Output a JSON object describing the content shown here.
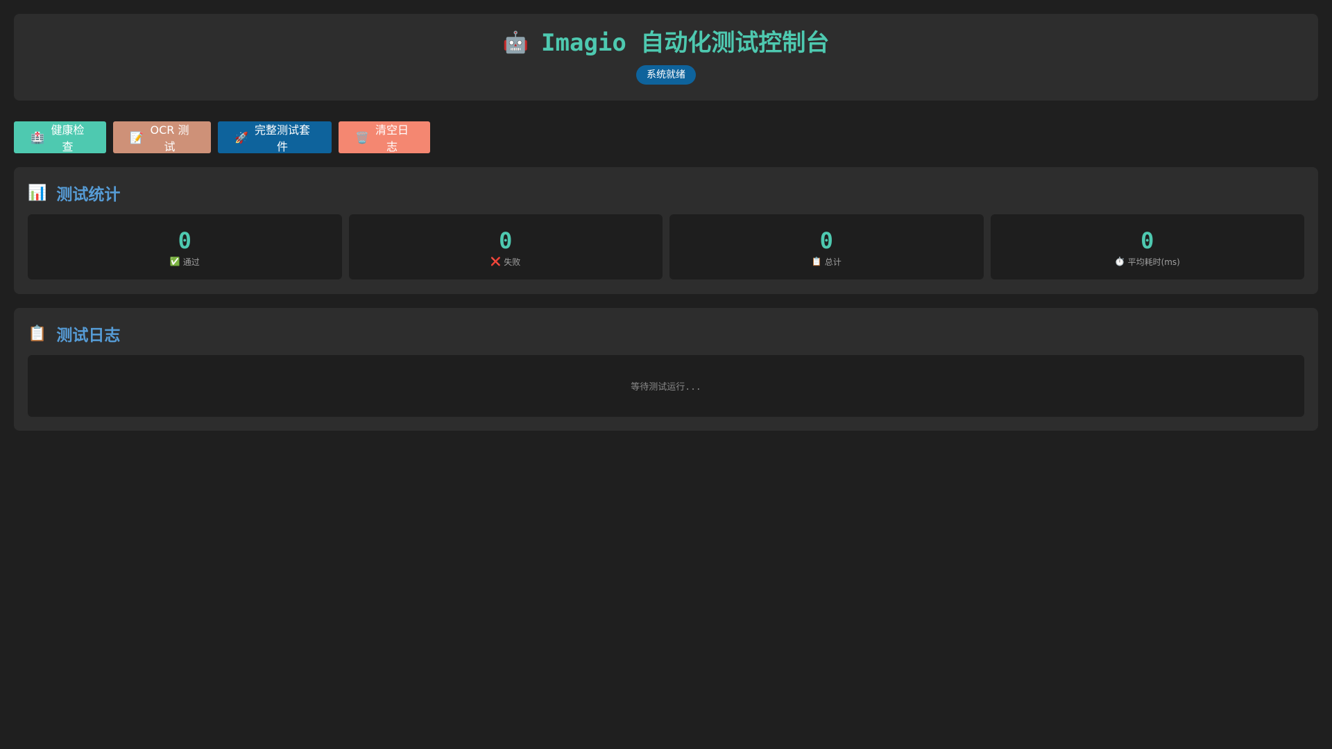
{
  "header": {
    "icon": "🤖",
    "title": "Imagio 自动化测试控制台",
    "status": "系统就绪"
  },
  "toolbar": {
    "health": {
      "icon": "🏥",
      "label": "健康检查"
    },
    "ocr": {
      "icon": "📝",
      "label": "OCR 测试"
    },
    "suite": {
      "icon": "🚀",
      "label": "完整测试套件"
    },
    "clear": {
      "icon": "🗑️",
      "label": "清空日志"
    }
  },
  "stats": {
    "icon": "📊",
    "title": "测试统计",
    "cards": [
      {
        "value": "0",
        "icon": "✅",
        "label": "通过"
      },
      {
        "value": "0",
        "icon": "❌",
        "label": "失败"
      },
      {
        "value": "0",
        "icon": "📋",
        "label": "总计"
      },
      {
        "value": "0",
        "icon": "⏱️",
        "label": "平均耗时(ms)"
      }
    ]
  },
  "log": {
    "icon": "📋",
    "title": "测试日志",
    "placeholder": "等待测试运行..."
  },
  "colors": {
    "background": "#1f1f1f",
    "panel": "#2d2d2d",
    "accent_teal": "#4ec9b0",
    "accent_blue": "#0e639c",
    "heading_blue": "#569cd6",
    "ocr_button": "#ce9178",
    "clear_button": "#f48771"
  }
}
